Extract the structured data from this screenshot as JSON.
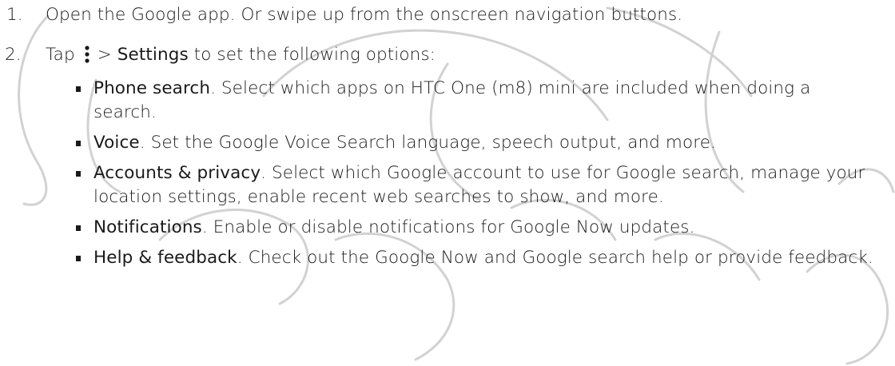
{
  "steps": [
    {
      "number": "1.",
      "text": "Open the Google app. Or swipe up from the onscreen navigation buttons."
    },
    {
      "number": "2.",
      "prefix": "Tap",
      "menu_icon": "more-vertical-icon",
      "separator": ">",
      "keyword": "Settings",
      "suffix": "to set the following options:",
      "options": [
        {
          "title": "Phone search",
          "description": ". Select which apps on HTC One (m8) mini are included when doing a search."
        },
        {
          "title": "Voice",
          "description": ". Set the Google Voice Search language, speech output, and more."
        },
        {
          "title": "Accounts & privacy",
          "description": ". Select which Google account to use for Google search, manage your location settings, enable recent web searches to show, and more."
        },
        {
          "title": "Notifications",
          "description": ". Enable or disable notifications for Google Now updates."
        },
        {
          "title": "Help & feedback",
          "description": ". Check out the Google Now and Google search help or provide feedback."
        }
      ]
    }
  ],
  "colors": {
    "text": "#1a1a1a",
    "watermark": "#cfcfcf"
  }
}
